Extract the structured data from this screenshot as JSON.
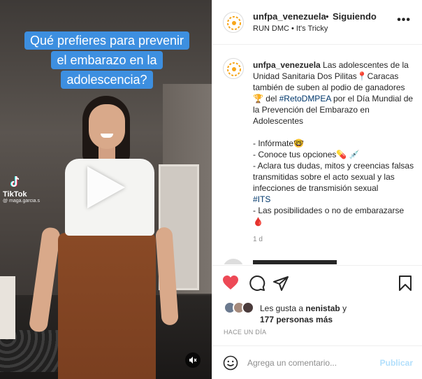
{
  "video": {
    "caption_lines": [
      "Qué prefieres para prevenir",
      "el embarazo en la",
      "adolescencia?"
    ],
    "watermark_brand": "TikTok",
    "watermark_handle": "@ maga.garcia.s",
    "icons": {
      "play": "play-icon",
      "mute": "mute-icon",
      "tiktok": "tiktok-logo-icon"
    }
  },
  "header": {
    "username": "unfpa_venezuela",
    "separator": "•",
    "follow_status": "Siguiendo",
    "music": "RUN DMC • It's Tricky",
    "more": "•••"
  },
  "caption": {
    "username": "unfpa_venezuela",
    "text_a": " Las adolescentes de la Unidad Sanitaria Dos Pilitas📍Caracas también de suben al podio de ganadores 🏆 del ",
    "hashtag1": "#RetoDMPEA",
    "text_b": " por el Día Mundial de la Prevención del Embarazo en Adolescentes",
    "bullet1": "- Infórmate🤓",
    "bullet2": "- Conoce tus opciones💊 💉",
    "bullet3": "- Aclara tus dudas, mitos y creencias falsas transmitidas sobre el acto sexual y las infecciones de transmisión sexual",
    "hashtag2": "#ITS",
    "bullet4": "- Las posibilidades o no de embarazarse 🩸",
    "time": "1 d"
  },
  "actions": {
    "icons": [
      "heart-icon",
      "comment-icon",
      "share-icon",
      "bookmark-icon"
    ],
    "likes_prefix": "Les gusta a ",
    "likes_user": "nenistab",
    "likes_mid": " y ",
    "likes_count": "177 personas más",
    "time_ago": "HACE UN DÍA"
  },
  "comment_bar": {
    "placeholder": "Agrega un comentario...",
    "publish": "Publicar"
  },
  "colors": {
    "heart": "#ed4956",
    "caption_bg": "#3d8fe0",
    "link": "#00376b",
    "publish_disabled": "#b2dffc"
  }
}
